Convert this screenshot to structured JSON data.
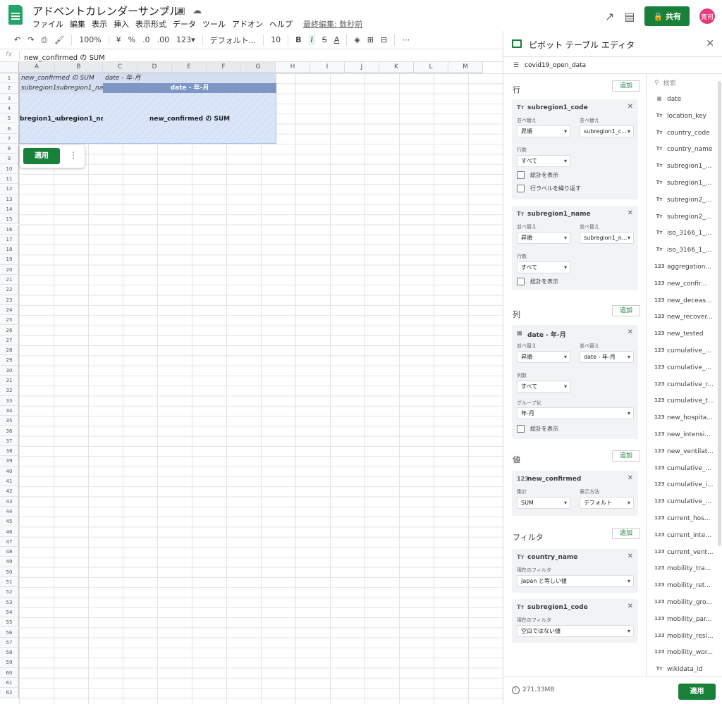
{
  "header": {
    "doc_title": "アドベントカレンダーサンプル",
    "menus": [
      "ファイル",
      "編集",
      "表示",
      "挿入",
      "表示形式",
      "データ",
      "ツール",
      "アドオン",
      "ヘルプ"
    ],
    "last_edit": "最終編集: 数秒前",
    "share_label": "共有",
    "avatar_text": "寛司"
  },
  "toolbar": {
    "zoom": "100%",
    "currency": "¥",
    "percent": "%",
    "dec_less": ".0",
    "dec_more": ".00",
    "number_format": "123▾",
    "font": "デフォルト...",
    "font_size": "10",
    "bold": "B",
    "italic": "I",
    "strike": "S",
    "text_color": "A"
  },
  "formula_bar": {
    "label": "fx",
    "value": "new_confirmed の SUM"
  },
  "sheet": {
    "columns": [
      "A",
      "B",
      "C",
      "D",
      "E",
      "F",
      "G",
      "H",
      "I",
      "J",
      "K",
      "L",
      "M"
    ],
    "rows": [
      "1",
      "2",
      "3",
      "4",
      "5",
      "6",
      "7",
      "8",
      "9",
      "10",
      "11",
      "12",
      "13",
      "14",
      "15",
      "16",
      "17",
      "18",
      "19",
      "20",
      "21",
      "22",
      "23",
      "24",
      "25",
      "26",
      "27",
      "28",
      "29",
      "30",
      "31",
      "32",
      "33",
      "34",
      "35",
      "36",
      "37",
      "38",
      "39",
      "40",
      "41",
      "42",
      "43",
      "44",
      "45",
      "46",
      "47",
      "48",
      "49",
      "50",
      "51",
      "52",
      "53",
      "54",
      "55",
      "56",
      "57",
      "58",
      "59",
      "60",
      "61",
      "62"
    ],
    "pivot": {
      "a1": "new_confirmed の SUM",
      "c1": "date - 年-月",
      "a2": "subregion1_",
      "b2": "subregion1_name",
      "header_date": "date - 年-月",
      "a5": "bregion1_c",
      "b5": "ubregion1_name",
      "d5": "new_confirmed の SUM"
    },
    "apply_label": "適用"
  },
  "pivot_editor": {
    "title": "ピボット テーブル エディタ",
    "source": "covid19_open_data",
    "add_label": "追加",
    "rows_label": "行",
    "cols_label": "列",
    "values_label": "値",
    "filter_label": "フィルタ",
    "sort_label": "並べ替え",
    "sortby_label": "並べ替え",
    "row_count_label": "行数",
    "col_count_label": "列数",
    "show_totals": "総計を表示",
    "repeat_labels": "行ラベルを繰り返す",
    "group_label": "グループ化",
    "summarize_label": "集計",
    "showas_label": "表示方法",
    "filter_current": "現在のフィルタ",
    "row_cards": [
      {
        "type": "Tт",
        "name": "subregion1_code",
        "order": "昇順",
        "by": "subregion1_c...",
        "count": "すべて"
      },
      {
        "type": "Tт",
        "name": "subregion1_name",
        "order": "昇順",
        "by": "subregion1_n...",
        "count": "すべて"
      }
    ],
    "col_card": {
      "type": "▦",
      "name": "date - 年-月",
      "order": "昇順",
      "by": "date - 年-月",
      "count": "すべて",
      "group": "年-月"
    },
    "value_card": {
      "type": "123",
      "name": "new_confirmed",
      "summarize": "SUM",
      "showas": "デフォルト"
    },
    "filter_cards": [
      {
        "type": "Tт",
        "name": "country_name",
        "value": "Japan と等しい値"
      },
      {
        "type": "Tт",
        "name": "subregion1_code",
        "value": "空白ではない値"
      }
    ],
    "search_placeholder": "検索",
    "fields": [
      {
        "type": "▦",
        "name": "date"
      },
      {
        "type": "Tт",
        "name": "location_key"
      },
      {
        "type": "Tт",
        "name": "country_code"
      },
      {
        "type": "Tт",
        "name": "country_name"
      },
      {
        "type": "Tт",
        "name": "subregion1_..."
      },
      {
        "type": "Tт",
        "name": "subregion1_..."
      },
      {
        "type": "Tт",
        "name": "subregion2_..."
      },
      {
        "type": "Tт",
        "name": "subregion2_..."
      },
      {
        "type": "Tт",
        "name": "iso_3166_1_..."
      },
      {
        "type": "Tт",
        "name": "iso_3166_1_..."
      },
      {
        "type": "123",
        "name": "aggregation..."
      },
      {
        "type": "123",
        "name": "new_confir..."
      },
      {
        "type": "123",
        "name": "new_deceas..."
      },
      {
        "type": "123",
        "name": "new_recover..."
      },
      {
        "type": "123",
        "name": "new_tested"
      },
      {
        "type": "123",
        "name": "cumulative_..."
      },
      {
        "type": "123",
        "name": "cumulative_..."
      },
      {
        "type": "123",
        "name": "cumulative_r..."
      },
      {
        "type": "123",
        "name": "cumulative_t..."
      },
      {
        "type": "123",
        "name": "new_hospita..."
      },
      {
        "type": "123",
        "name": "new_intensi..."
      },
      {
        "type": "123",
        "name": "new_ventilat..."
      },
      {
        "type": "123",
        "name": "cumulative_..."
      },
      {
        "type": "123",
        "name": "cumulative_i..."
      },
      {
        "type": "123",
        "name": "cumulative_..."
      },
      {
        "type": "123",
        "name": "current_hos..."
      },
      {
        "type": "123",
        "name": "current_inte..."
      },
      {
        "type": "123",
        "name": "current_vent..."
      },
      {
        "type": "123",
        "name": "mobility_tra..."
      },
      {
        "type": "123",
        "name": "mobility_ret..."
      },
      {
        "type": "123",
        "name": "mobility_gro..."
      },
      {
        "type": "123",
        "name": "mobility_par..."
      },
      {
        "type": "123",
        "name": "mobility_resi..."
      },
      {
        "type": "123",
        "name": "mobility_wor..."
      },
      {
        "type": "Tт",
        "name": "wikidata_id"
      }
    ],
    "memory": "271.33MB",
    "apply_label": "適用"
  }
}
